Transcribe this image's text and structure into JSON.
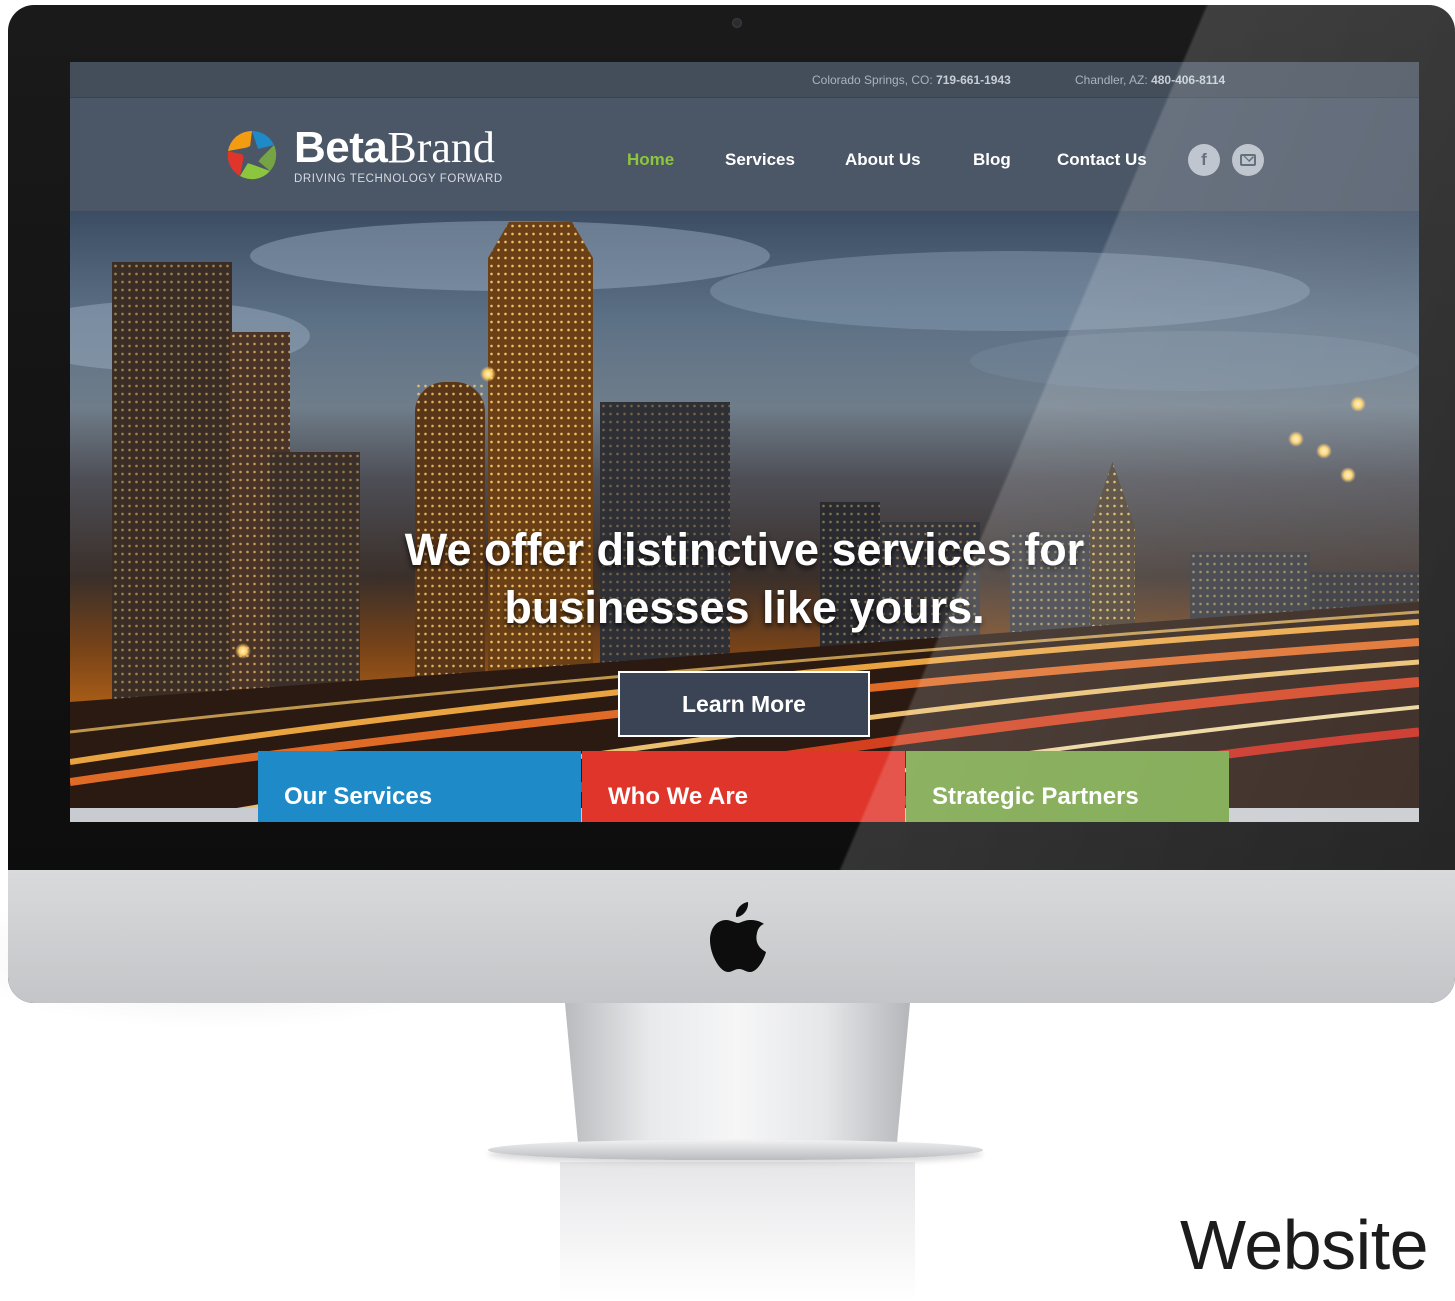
{
  "topbar": {
    "contact1_label": "Colorado Springs, CO:",
    "contact1_phone": "719-661-1943",
    "contact2_label": "Chandler, AZ:",
    "contact2_phone": "480-406-8114"
  },
  "brand": {
    "name_bold": "Beta",
    "name_light": "Brand",
    "tagline": "DRIVING TECHNOLOGY FORWARD"
  },
  "nav": {
    "items": [
      {
        "label": "Home",
        "active": true
      },
      {
        "label": "Services"
      },
      {
        "label": "About Us"
      },
      {
        "label": "Blog"
      },
      {
        "label": "Contact Us"
      }
    ],
    "social": [
      {
        "icon": "facebook-icon",
        "glyph": "f"
      },
      {
        "icon": "mail-icon"
      }
    ],
    "active_color": "#8cc63f"
  },
  "hero": {
    "headline_line1": "We offer distinctive services for",
    "headline_line2": "businesses like yours.",
    "cta_label": "Learn More"
  },
  "tiles": [
    {
      "label": "Our Services",
      "color": "#1e8ac7"
    },
    {
      "label": "Who We Are",
      "color": "#e0352a"
    },
    {
      "label": "Strategic Partners",
      "color": "#76a344"
    }
  ],
  "caption": "Website"
}
